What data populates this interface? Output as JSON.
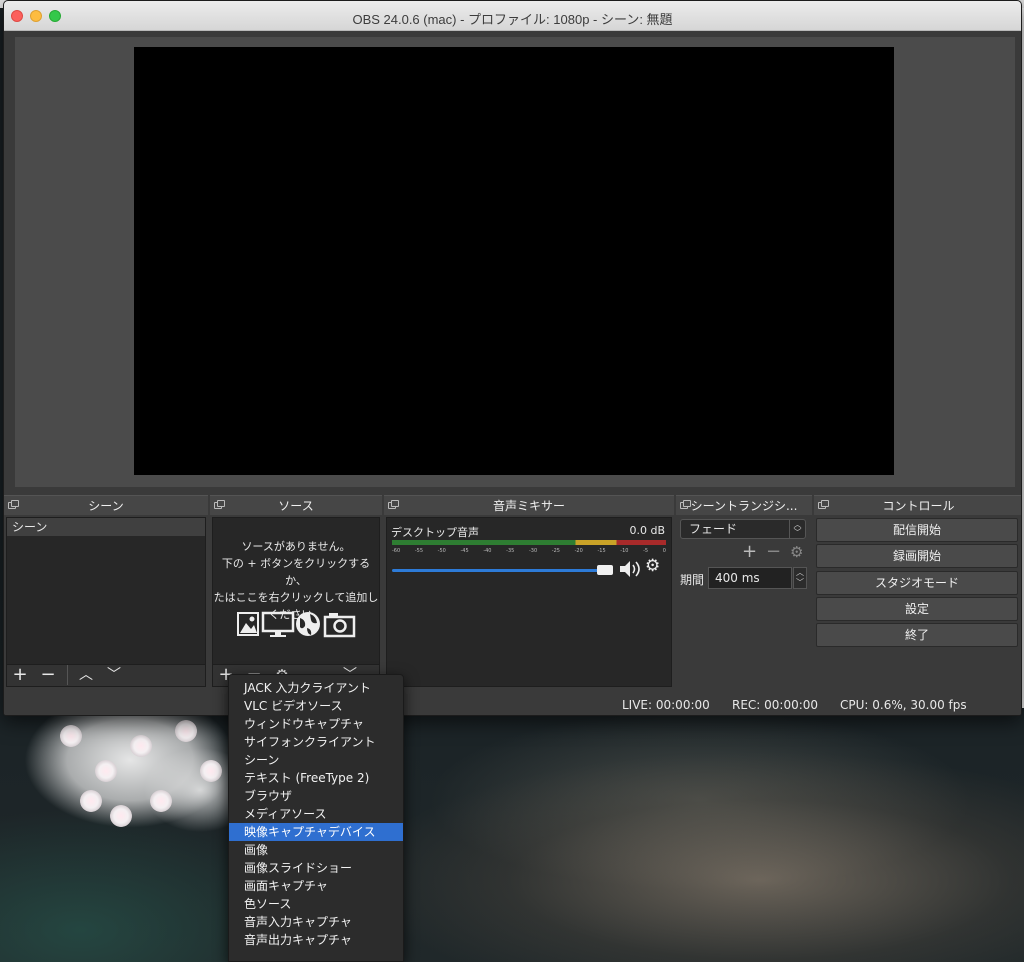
{
  "window": {
    "title": "OBS 24.0.6 (mac) - プロファイル: 1080p - シーン: 無題"
  },
  "docks": {
    "scenes": {
      "title": "シーン",
      "items": [
        "シーン"
      ],
      "toolbar_icons": [
        "plus-icon",
        "minus-icon",
        "chevron-up-icon",
        "chevron-down-icon"
      ]
    },
    "sources": {
      "title": "ソース",
      "empty_message": "ソースがありません。\n下の + ボタンをクリックするか、\nたはここを右クリックして追加し\nください。",
      "empty_icons": [
        "image-icon",
        "display-icon",
        "globe-icon",
        "camera-icon"
      ],
      "toolbar_icons": [
        "plus-icon",
        "minus-icon",
        "gear-icon",
        "chevron-up-icon",
        "chevron-down-icon"
      ]
    },
    "mixer": {
      "title": "音声ミキサー",
      "channel_name": "デスクトップ音声",
      "level": "0.0 dB",
      "meter_ticks": [
        "-60",
        "-55",
        "-50",
        "-45",
        "-40",
        "-35",
        "-30",
        "-25",
        "-20",
        "-15",
        "-10",
        "-5",
        "0"
      ],
      "volume_fraction": 1.0
    },
    "transitions": {
      "title": "シーントランジシ...",
      "selected": "フェード",
      "duration_label": "期間",
      "duration_value": "400 ms"
    },
    "controls": {
      "title": "コントロール",
      "buttons": [
        "配信開始",
        "録画開始",
        "スタジオモード",
        "設定",
        "終了"
      ]
    }
  },
  "status": {
    "live": "LIVE: 00:00:00",
    "rec": "REC: 00:00:00",
    "cpu": "CPU: 0.6%, 30.00 fps"
  },
  "context_menu": {
    "items": [
      "JACK 入力クライアント",
      "VLC ビデオソース",
      "ウィンドウキャプチャ",
      "サイフォンクライアント",
      "シーン",
      "テキスト (FreeType 2)",
      "ブラウザ",
      "メディアソース",
      "映像キャプチャデバイス",
      "画像",
      "画像スライドショー",
      "画面キャプチャ",
      "色ソース",
      "音声入力キャプチャ",
      "音声出力キャプチャ"
    ],
    "selected_index": 8
  },
  "colors": {
    "accent": "#2f6fd0",
    "slider": "#2d7bd8",
    "meter_green": "#2e7d32",
    "meter_yellow": "#c9a227",
    "meter_red": "#a82a2a"
  }
}
